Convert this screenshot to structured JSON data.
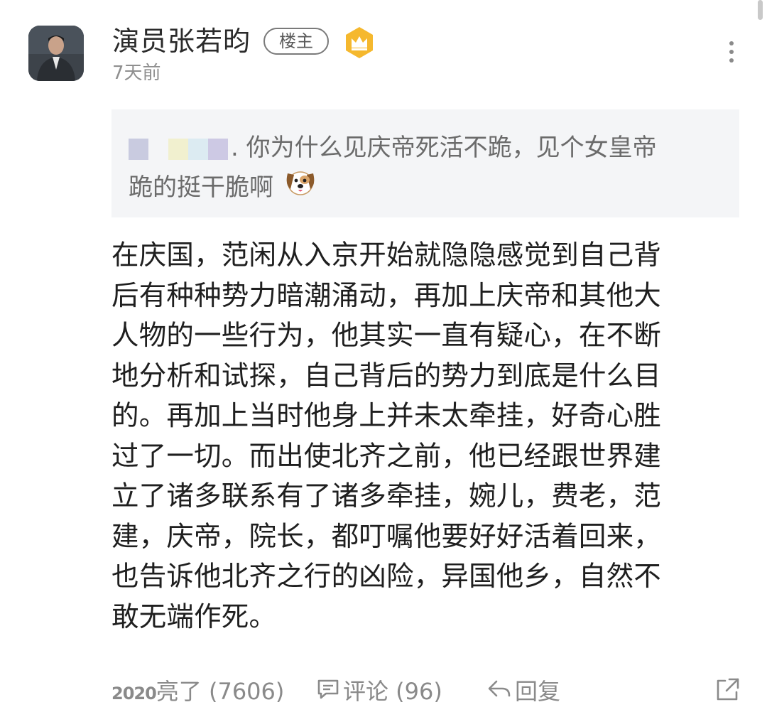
{
  "post": {
    "author": "演员张若昀",
    "op_badge": "楼主",
    "time": "7天前",
    "quote": {
      "line1_suffix": ". 你为什么见庆帝死活不跪，见个女皇帝",
      "line2": "跪的挺干脆啊",
      "emoji": "dog-face"
    },
    "body_lines": [
      "在庆国，范闲从入京开始就隐隐感觉到自己背",
      "后有种种势力暗潮涌动，再加上庆帝和其他大",
      "人物的一些行为，他其实一直有疑心，在不断",
      "地分析和试探，自己背后的势力到底是什么目",
      "的。再加上当时他身上并未太牵挂，好奇心胜",
      "过了一切。而出使北齐之前，他已经跟世界建",
      "立了诸多联系有了诸多牵挂，婉儿，费老，范",
      "建，庆帝，院长，都叮嘱他要好好活着回来，",
      "也告诉他北齐之行的凶险，异国他乡，自然不",
      "敢无端作死。"
    ]
  },
  "actions": {
    "like_prefix": "2020",
    "like_label": "亮了 (7606)",
    "comment_label": "评论 (96)",
    "reply_label": "回复"
  },
  "icons": {
    "crown": "crown-badge-icon",
    "more": "more-vertical-icon",
    "comment": "comment-bubble-icon",
    "reply": "reply-arrow-icon",
    "share": "share-icon"
  },
  "colors": {
    "quote_bg": "#f4f5f7",
    "crown_gold": "#f5b82e",
    "muted_text": "#8a8a8a"
  }
}
